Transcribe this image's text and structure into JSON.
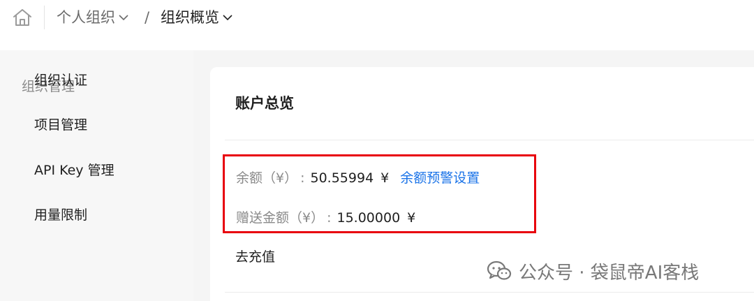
{
  "breadcrumb": {
    "items": [
      {
        "label": "个人组织"
      },
      {
        "label": "组织概览"
      }
    ],
    "separator": "/"
  },
  "sidebar": {
    "group_label": "组织管理",
    "items": [
      {
        "label": "组织认证"
      },
      {
        "label": "项目管理"
      },
      {
        "label": "API Key 管理"
      },
      {
        "label": "用量限制"
      }
    ]
  },
  "account_overview": {
    "title": "账户总览",
    "balance": {
      "label": "余额（¥）",
      "colon": ":",
      "value": "50.55994",
      "currency": "¥",
      "link": "余额预警设置"
    },
    "gift_balance": {
      "label": "赠送金额（¥）",
      "colon": ":",
      "value": "15.00000",
      "currency": "¥"
    },
    "recharge_label": "去充值"
  },
  "watermark": {
    "text": "公众号 · 袋鼠帝AI客栈",
    "icon": "wechat-icon"
  },
  "colors": {
    "link": "#1a73e8",
    "highlight_border": "#e8000c",
    "sidebar_bg": "#f7f7f7"
  }
}
